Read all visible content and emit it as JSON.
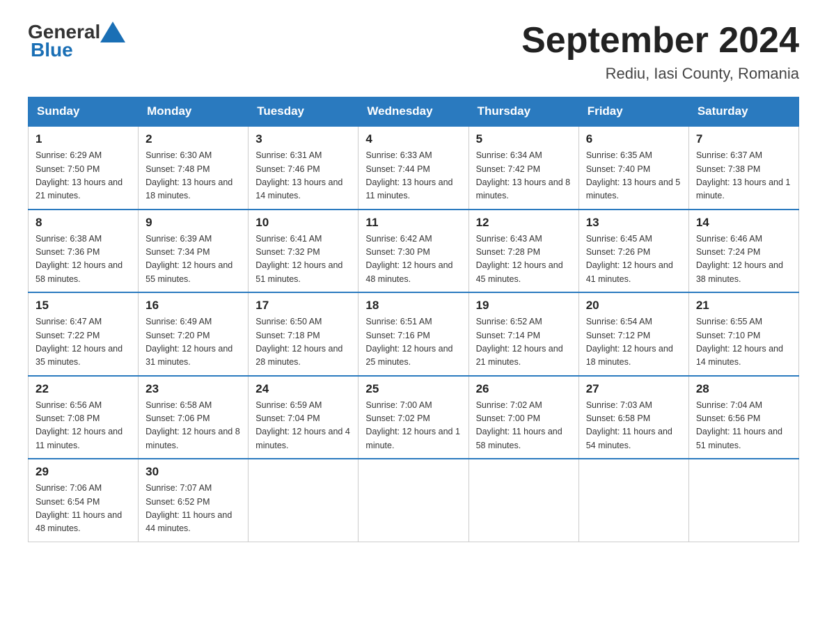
{
  "header": {
    "logo_general": "General",
    "logo_blue": "Blue",
    "title": "September 2024",
    "subtitle": "Rediu, Iasi County, Romania"
  },
  "weekdays": [
    "Sunday",
    "Monday",
    "Tuesday",
    "Wednesday",
    "Thursday",
    "Friday",
    "Saturday"
  ],
  "weeks": [
    [
      {
        "day": "1",
        "sunrise": "6:29 AM",
        "sunset": "7:50 PM",
        "daylight": "13 hours and 21 minutes."
      },
      {
        "day": "2",
        "sunrise": "6:30 AM",
        "sunset": "7:48 PM",
        "daylight": "13 hours and 18 minutes."
      },
      {
        "day": "3",
        "sunrise": "6:31 AM",
        "sunset": "7:46 PM",
        "daylight": "13 hours and 14 minutes."
      },
      {
        "day": "4",
        "sunrise": "6:33 AM",
        "sunset": "7:44 PM",
        "daylight": "13 hours and 11 minutes."
      },
      {
        "day": "5",
        "sunrise": "6:34 AM",
        "sunset": "7:42 PM",
        "daylight": "13 hours and 8 minutes."
      },
      {
        "day": "6",
        "sunrise": "6:35 AM",
        "sunset": "7:40 PM",
        "daylight": "13 hours and 5 minutes."
      },
      {
        "day": "7",
        "sunrise": "6:37 AM",
        "sunset": "7:38 PM",
        "daylight": "13 hours and 1 minute."
      }
    ],
    [
      {
        "day": "8",
        "sunrise": "6:38 AM",
        "sunset": "7:36 PM",
        "daylight": "12 hours and 58 minutes."
      },
      {
        "day": "9",
        "sunrise": "6:39 AM",
        "sunset": "7:34 PM",
        "daylight": "12 hours and 55 minutes."
      },
      {
        "day": "10",
        "sunrise": "6:41 AM",
        "sunset": "7:32 PM",
        "daylight": "12 hours and 51 minutes."
      },
      {
        "day": "11",
        "sunrise": "6:42 AM",
        "sunset": "7:30 PM",
        "daylight": "12 hours and 48 minutes."
      },
      {
        "day": "12",
        "sunrise": "6:43 AM",
        "sunset": "7:28 PM",
        "daylight": "12 hours and 45 minutes."
      },
      {
        "day": "13",
        "sunrise": "6:45 AM",
        "sunset": "7:26 PM",
        "daylight": "12 hours and 41 minutes."
      },
      {
        "day": "14",
        "sunrise": "6:46 AM",
        "sunset": "7:24 PM",
        "daylight": "12 hours and 38 minutes."
      }
    ],
    [
      {
        "day": "15",
        "sunrise": "6:47 AM",
        "sunset": "7:22 PM",
        "daylight": "12 hours and 35 minutes."
      },
      {
        "day": "16",
        "sunrise": "6:49 AM",
        "sunset": "7:20 PM",
        "daylight": "12 hours and 31 minutes."
      },
      {
        "day": "17",
        "sunrise": "6:50 AM",
        "sunset": "7:18 PM",
        "daylight": "12 hours and 28 minutes."
      },
      {
        "day": "18",
        "sunrise": "6:51 AM",
        "sunset": "7:16 PM",
        "daylight": "12 hours and 25 minutes."
      },
      {
        "day": "19",
        "sunrise": "6:52 AM",
        "sunset": "7:14 PM",
        "daylight": "12 hours and 21 minutes."
      },
      {
        "day": "20",
        "sunrise": "6:54 AM",
        "sunset": "7:12 PM",
        "daylight": "12 hours and 18 minutes."
      },
      {
        "day": "21",
        "sunrise": "6:55 AM",
        "sunset": "7:10 PM",
        "daylight": "12 hours and 14 minutes."
      }
    ],
    [
      {
        "day": "22",
        "sunrise": "6:56 AM",
        "sunset": "7:08 PM",
        "daylight": "12 hours and 11 minutes."
      },
      {
        "day": "23",
        "sunrise": "6:58 AM",
        "sunset": "7:06 PM",
        "daylight": "12 hours and 8 minutes."
      },
      {
        "day": "24",
        "sunrise": "6:59 AM",
        "sunset": "7:04 PM",
        "daylight": "12 hours and 4 minutes."
      },
      {
        "day": "25",
        "sunrise": "7:00 AM",
        "sunset": "7:02 PM",
        "daylight": "12 hours and 1 minute."
      },
      {
        "day": "26",
        "sunrise": "7:02 AM",
        "sunset": "7:00 PM",
        "daylight": "11 hours and 58 minutes."
      },
      {
        "day": "27",
        "sunrise": "7:03 AM",
        "sunset": "6:58 PM",
        "daylight": "11 hours and 54 minutes."
      },
      {
        "day": "28",
        "sunrise": "7:04 AM",
        "sunset": "6:56 PM",
        "daylight": "11 hours and 51 minutes."
      }
    ],
    [
      {
        "day": "29",
        "sunrise": "7:06 AM",
        "sunset": "6:54 PM",
        "daylight": "11 hours and 48 minutes."
      },
      {
        "day": "30",
        "sunrise": "7:07 AM",
        "sunset": "6:52 PM",
        "daylight": "11 hours and 44 minutes."
      },
      null,
      null,
      null,
      null,
      null
    ]
  ],
  "labels": {
    "sunrise_prefix": "Sunrise: ",
    "sunset_prefix": "Sunset: ",
    "daylight_prefix": "Daylight: "
  }
}
